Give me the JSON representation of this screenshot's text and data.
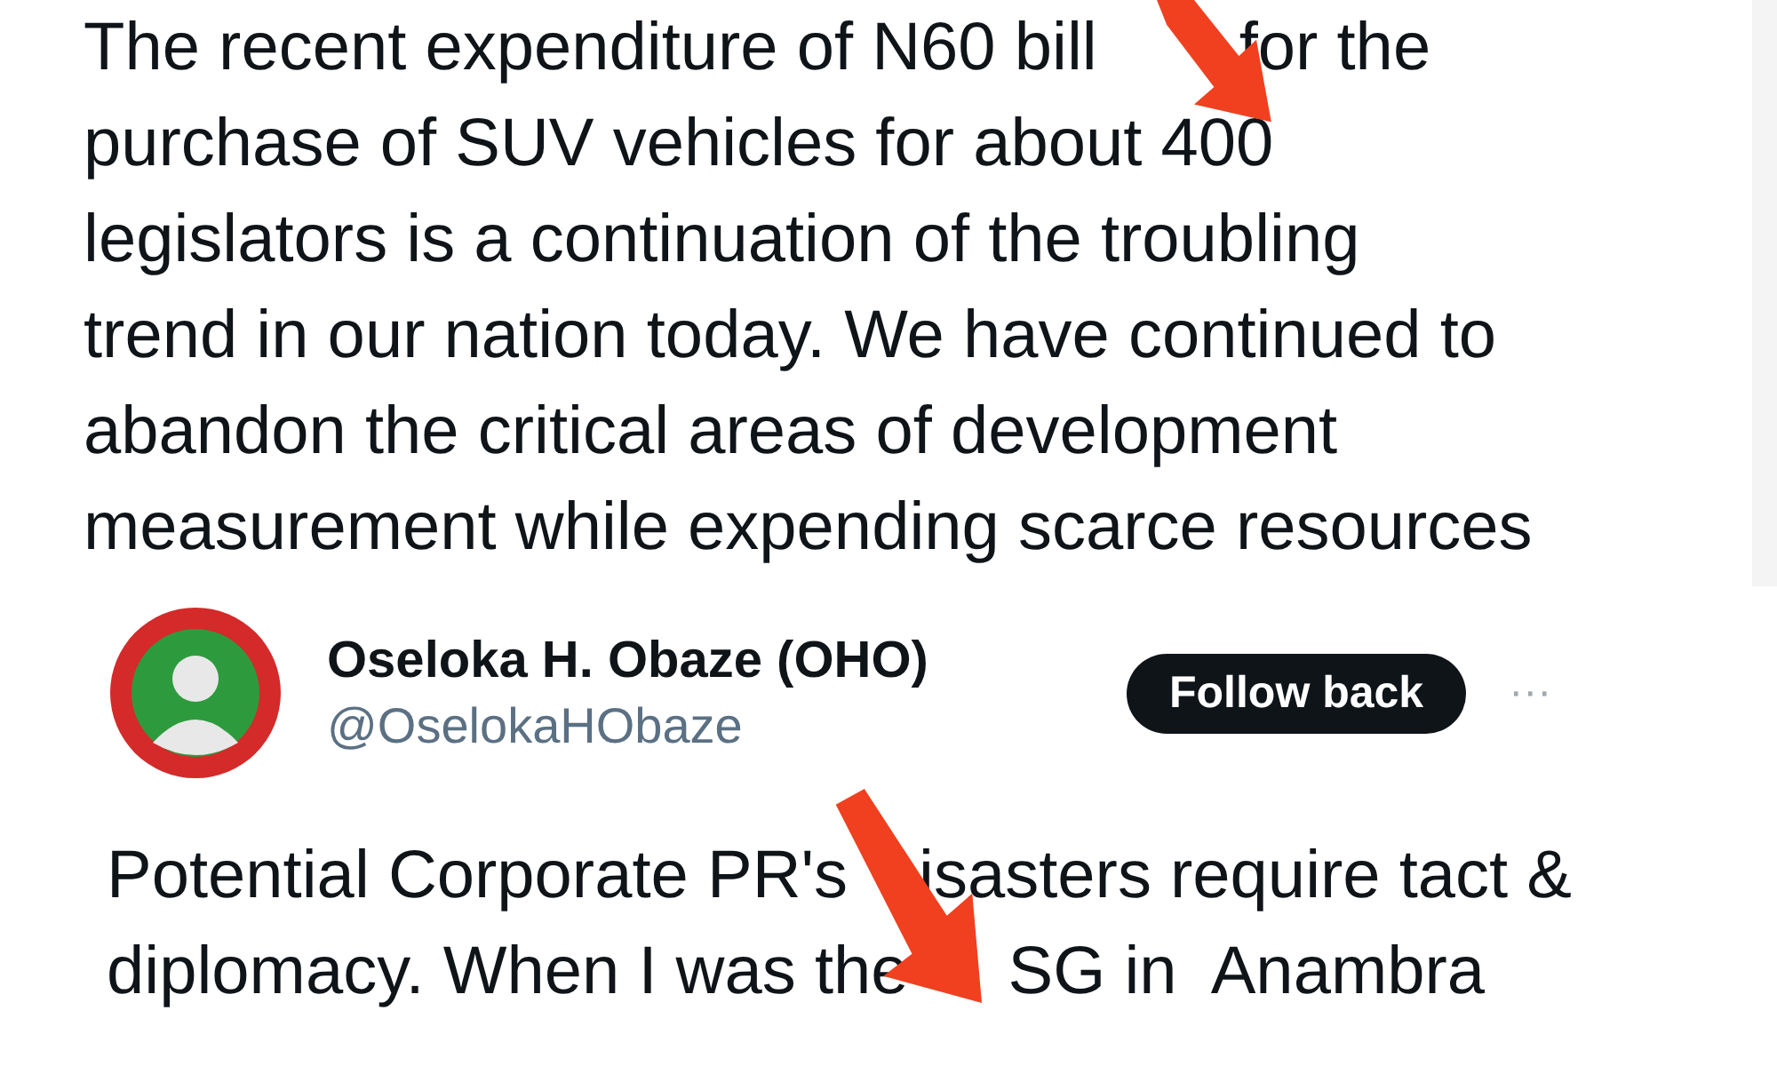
{
  "quoted_post": {
    "lines": [
      [
        "The recent expenditure of N60 bill",
        "for the"
      ],
      [
        "purchase of SUV vehicles for about 400"
      ],
      [
        "legislators is a continuation of the troubling"
      ],
      [
        "trend in our nation today. We have continued to"
      ],
      [
        "abandon the critical areas of development"
      ],
      [
        "measurement while expending scarce resources"
      ]
    ]
  },
  "post": {
    "author": {
      "name": "Oseloka H. Obaze (OHO)",
      "handle": "@OselokaHObaze"
    },
    "follow_button": "Follow back",
    "more": "···",
    "lines": [
      [
        "Potential Corporate PR's",
        "isasters require tact &"
      ],
      [
        "diplomacy. When I was the",
        "SG in  Anambra"
      ]
    ]
  }
}
